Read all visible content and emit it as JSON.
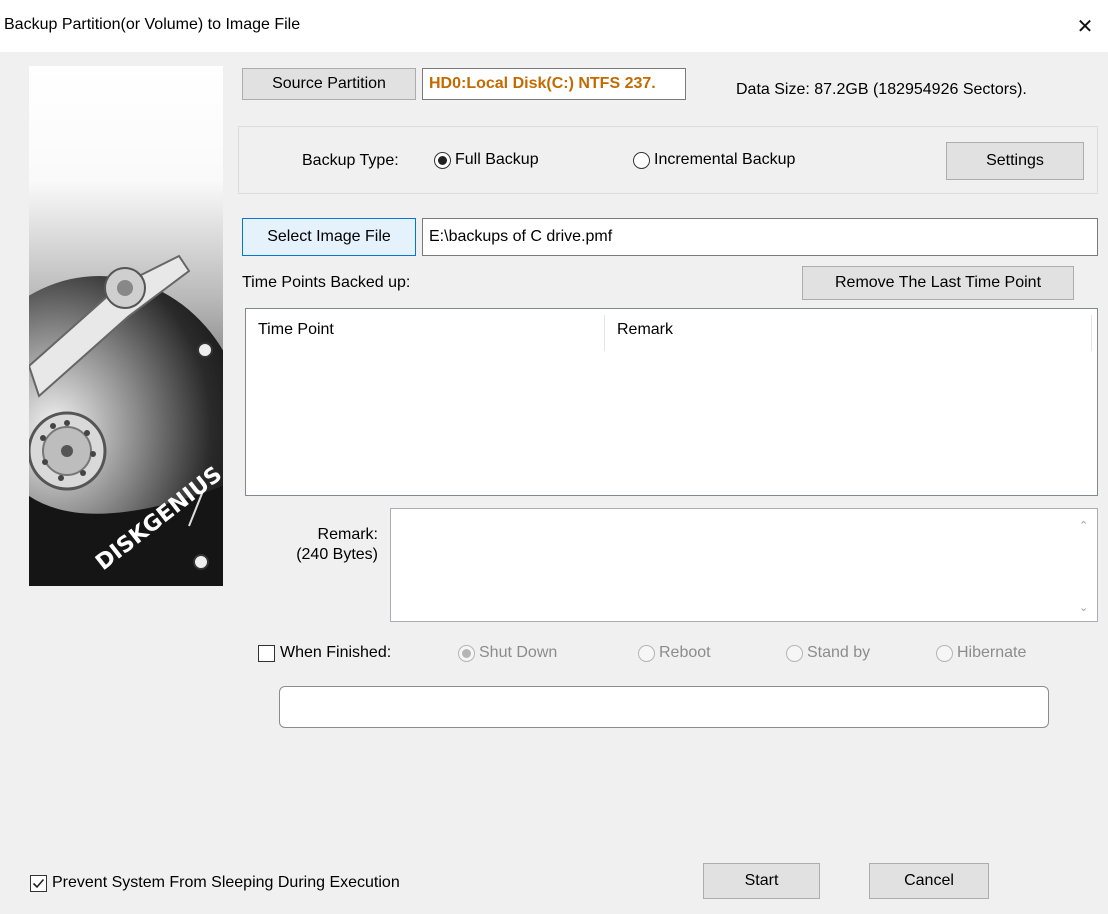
{
  "window": {
    "title": "Backup Partition(or Volume) to Image File",
    "close_glyph": "✕"
  },
  "source": {
    "button_label": "Source Partition",
    "value": "HD0:Local Disk(C:) NTFS 237.",
    "value_color": "#c36a00",
    "data_size": "Data Size: 87.2GB (182954926 Sectors)."
  },
  "backup_type": {
    "label": "Backup Type:",
    "options": [
      {
        "label": "Full Backup",
        "selected": true
      },
      {
        "label": "Incremental Backup",
        "selected": false
      }
    ],
    "settings_label": "Settings"
  },
  "image_file": {
    "button_label": "Select Image File",
    "value": "E:\\backups of C drive.pmf"
  },
  "time_points": {
    "label": "Time Points Backed up:",
    "remove_button_label": "Remove The Last Time Point",
    "columns": [
      "Time Point",
      "Remark"
    ],
    "rows": []
  },
  "remark": {
    "label": "Remark:",
    "sublabel": "(240 Bytes)",
    "value": ""
  },
  "when_finished": {
    "label": "When Finished:",
    "checked": false,
    "options": [
      {
        "label": "Shut Down",
        "selected": true
      },
      {
        "label": "Reboot",
        "selected": false
      },
      {
        "label": "Stand by",
        "selected": false
      },
      {
        "label": "Hibernate",
        "selected": false
      }
    ]
  },
  "progress": {
    "value": 0
  },
  "prevent_sleep": {
    "label": "Prevent System From Sleeping During Execution",
    "checked": true
  },
  "footer": {
    "start_label": "Start",
    "cancel_label": "Cancel"
  },
  "sidebar_image": {
    "logo_text": "DISKGENIUS",
    "icon": "hard-disk-icon"
  }
}
